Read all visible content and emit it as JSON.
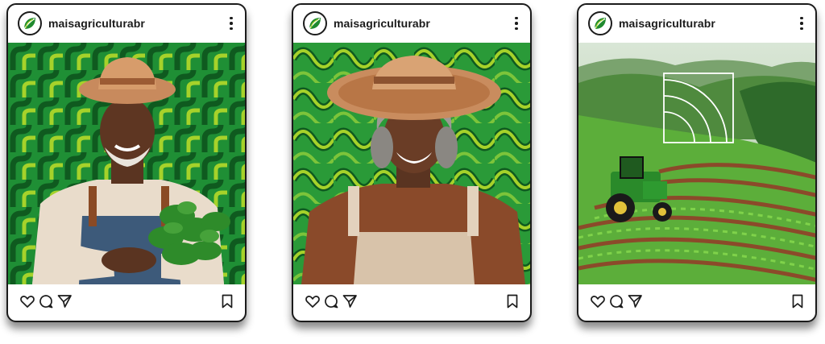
{
  "colors": {
    "brand_green": "#1f8a2e",
    "brand_dark_green": "#0f5a1f",
    "brand_lime": "#a6d22a",
    "frame": "#1b1b1b"
  },
  "posts": [
    {
      "username": "maisagriculturabr",
      "avatar_icon": "leaf-logo-icon",
      "menu_icon": "more-vertical-icon",
      "image_subject": "farmer-with-basil",
      "actions": [
        "heart-icon",
        "comment-icon",
        "share-icon",
        "bookmark-icon"
      ]
    },
    {
      "username": "maisagriculturabr",
      "avatar_icon": "leaf-logo-icon",
      "menu_icon": "more-vertical-icon",
      "image_subject": "smiling-woman-farmer",
      "actions": [
        "heart-icon",
        "comment-icon",
        "share-icon",
        "bookmark-icon"
      ]
    },
    {
      "username": "maisagriculturabr",
      "avatar_icon": "leaf-logo-icon",
      "menu_icon": "more-vertical-icon",
      "image_subject": "tractor-in-field",
      "actions": [
        "heart-icon",
        "comment-icon",
        "share-icon",
        "bookmark-icon"
      ]
    }
  ]
}
